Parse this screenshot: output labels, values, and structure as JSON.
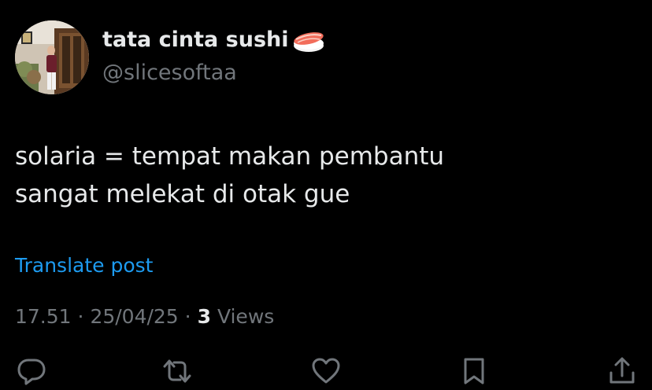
{
  "author": {
    "display_name": "tata cinta sushi",
    "display_name_emoji": "sushi-emoji",
    "handle": "@slicesoftaa"
  },
  "tweet": {
    "lines": [
      "solaria = tempat makan pembantu",
      "sangat melekat di otak gue"
    ]
  },
  "translate_label": "Translate post",
  "meta": {
    "time": "17.51",
    "separator": "·",
    "date": "25/04/25",
    "views_count": "3",
    "views_label": "Views"
  },
  "actions": {
    "icons": [
      "reply-icon",
      "retweet-icon",
      "like-icon",
      "bookmark-icon",
      "share-icon"
    ]
  },
  "colors": {
    "background": "#000000",
    "primary_text": "#e7e9ea",
    "secondary_text": "#71767b",
    "link": "#1d9bf0"
  }
}
